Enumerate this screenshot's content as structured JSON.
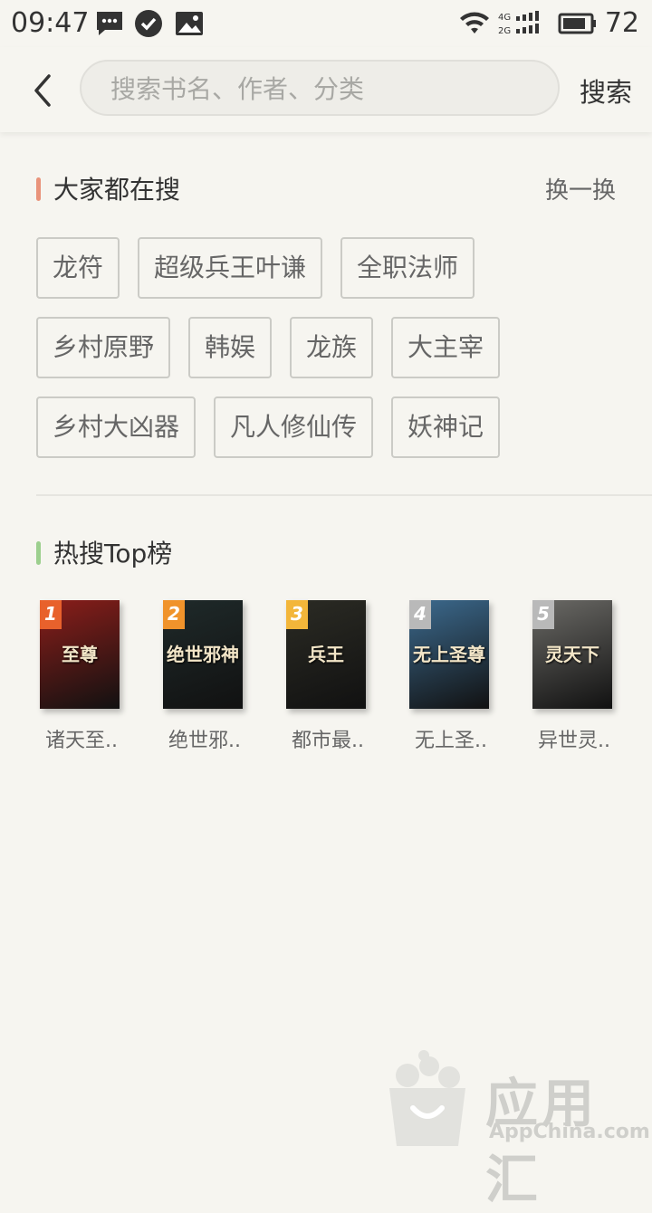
{
  "status_bar": {
    "time": "09:47",
    "battery": "72"
  },
  "search": {
    "placeholder": "搜索书名、作者、分类",
    "button_label": "搜索"
  },
  "popular": {
    "title": "大家都在搜",
    "refresh_label": "换一换",
    "rows": [
      [
        "龙符",
        "超级兵王叶谦",
        "全职法师"
      ],
      [
        "乡村原野",
        "韩娱",
        "龙族",
        "大主宰"
      ],
      [
        "乡村大凶器",
        "凡人修仙传",
        "妖神记"
      ]
    ]
  },
  "top": {
    "title": "热搜Top榜",
    "books": [
      {
        "rank": "1",
        "title": "诸天至..",
        "cover_text": "至尊",
        "rank_color": "#e8612c",
        "cover_color": "#8b1e1a"
      },
      {
        "rank": "2",
        "title": "绝世邪..",
        "cover_text": "绝世邪神",
        "rank_color": "#f0932b",
        "cover_color": "#1f2a2a"
      },
      {
        "rank": "3",
        "title": "都市最..",
        "cover_text": "兵王",
        "rank_color": "#f3b63a",
        "cover_color": "#2b2b24"
      },
      {
        "rank": "4",
        "title": "无上圣..",
        "cover_text": "无上圣尊",
        "rank_color": "#b9b9b9",
        "cover_color": "#3c6a8e"
      },
      {
        "rank": "5",
        "title": "异世灵..",
        "cover_text": "灵天下",
        "rank_color": "#b9b9b9",
        "cover_color": "#6b6a66"
      }
    ]
  },
  "watermark": {
    "text": "应用汇",
    "sub": "AppChina.com"
  }
}
